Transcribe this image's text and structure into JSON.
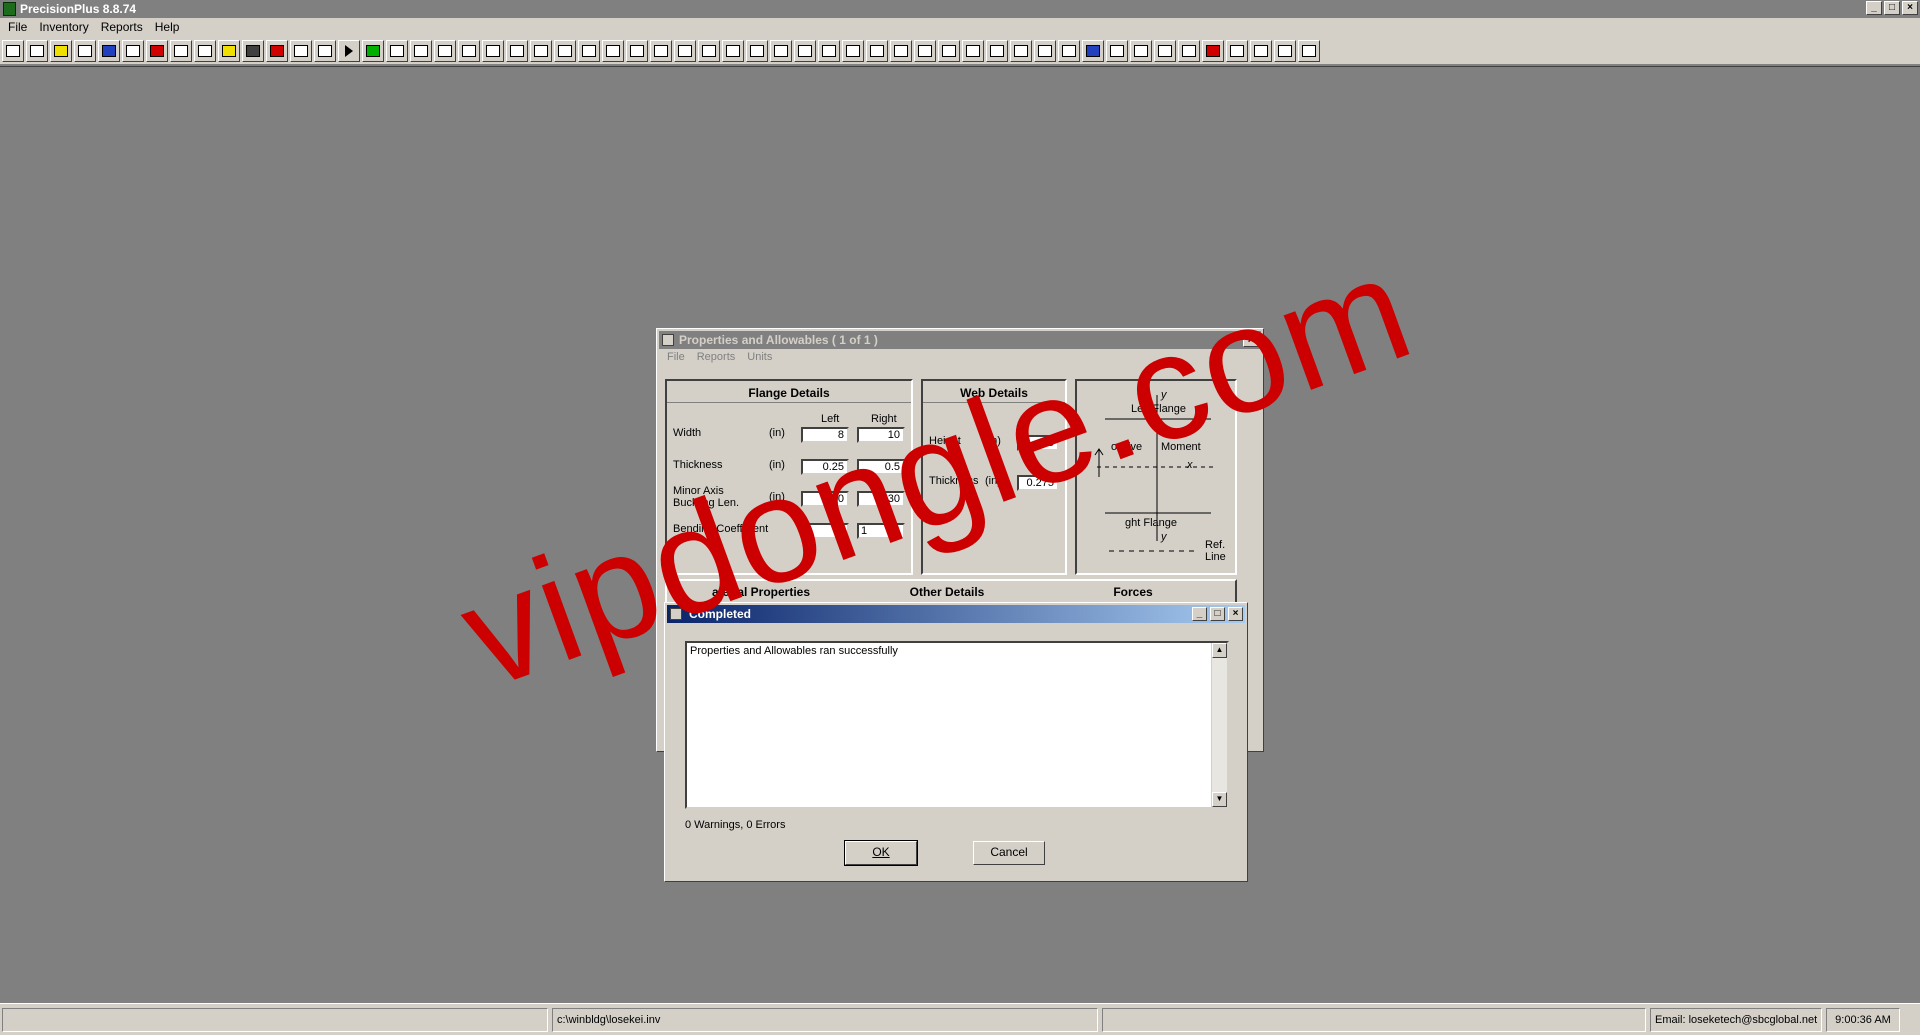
{
  "app": {
    "title": "PrecisionPlus 8.8.74",
    "menu": [
      "File",
      "Inventory",
      "Reports",
      "Help"
    ]
  },
  "toolbar": {
    "buttons": [
      "new",
      "open",
      "folder",
      "grid",
      "save",
      "props",
      "stop",
      "book",
      "book2",
      "chart",
      "eraser",
      "cancel",
      "table",
      "tree",
      "run",
      "green-grid",
      "list",
      "beam",
      "profile",
      "columns",
      "truss",
      "frame",
      "wall",
      "stair",
      "angle",
      "connector",
      "gable",
      "split",
      "plate",
      "bracket",
      "weld",
      "slope",
      "cross",
      "target",
      "rafter",
      "arch",
      "hook",
      "curve",
      "web",
      "box",
      "window",
      "panel",
      "door",
      "columns2",
      "flags",
      "eye",
      "arch2",
      "seat",
      "hinge",
      "roof",
      "red-block",
      "cube",
      "house",
      "building",
      "grid2"
    ]
  },
  "properties_dialog": {
    "title": "Properties and  Allowables ( 1 of 1 )",
    "menu": [
      "File",
      "Reports",
      "Units"
    ],
    "flange": {
      "heading": "Flange Details",
      "col_left": "Left",
      "col_right": "Right",
      "rows": [
        {
          "label": "Width",
          "unit": "(in)",
          "left": "8",
          "right": "10"
        },
        {
          "label": "Thickness",
          "unit": "(in)",
          "left": "0.25",
          "right": "0.5"
        },
        {
          "label": "Minor Axis",
          "label2": "Buckling Len.",
          "unit": "(in)",
          "left": "30",
          "right": "30"
        },
        {
          "label": "Bending Coefficient",
          "unit": "",
          "left": "1.",
          "right": "1"
        }
      ]
    },
    "web": {
      "heading": "Web Details",
      "rows": [
        {
          "label": "Height",
          "unit": "(in)",
          "value": "15"
        },
        {
          "label": "Thickness",
          "unit": "(in)",
          "value": "0.275"
        }
      ]
    },
    "diagram": {
      "y_top": "y",
      "left_flange": "Left Flange",
      "positive": "ositive",
      "moment": "Moment",
      "x": "x",
      "right_flange": "ght Flange",
      "y_bottom": "y",
      "ref": "Ref.",
      "line": "Line"
    },
    "tabs": [
      "aterial Properties",
      "Other Details",
      "Forces"
    ]
  },
  "completed_dialog": {
    "title": "Completed",
    "message": "Properties and Allowables ran successfully",
    "status": "0 Warnings, 0 Errors",
    "ok_label": "OK",
    "cancel_label": "Cancel"
  },
  "statusbar": {
    "path": "c:\\winbldg\\losekei.inv",
    "email": "Email: loseketech@sbcglobal.net",
    "time": "9:00:36 AM"
  },
  "watermark": "vipdongle.com"
}
